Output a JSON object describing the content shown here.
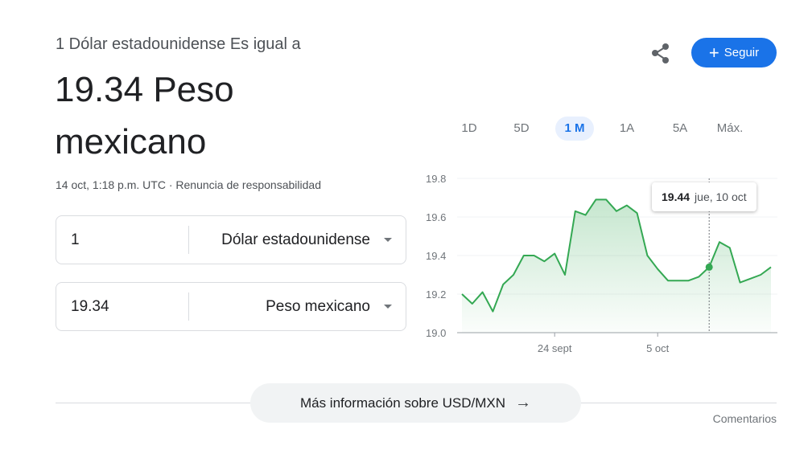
{
  "header": {
    "subtitle": "1 Dólar estadounidense Es igual a",
    "result_line1": "19.34 Peso",
    "result_line2": "mexicano",
    "timestamp": "14 oct, 1:18 p.m. UTC",
    "separator": "·",
    "disclaimer_link": "Renuncia de responsabilidad"
  },
  "actions": {
    "share_icon": "share-icon",
    "follow_label": "Seguir",
    "follow_icon": "+",
    "accent_color": "#1a73e8"
  },
  "converter": {
    "from": {
      "value": "1",
      "currency": "Dólar estadounidense"
    },
    "to": {
      "value": "19.34",
      "currency": "Peso mexicano"
    }
  },
  "ranges": {
    "items": [
      "1D",
      "5D",
      "1 M",
      "1A",
      "5A",
      "Máx."
    ],
    "selected": "1 M"
  },
  "tooltip": {
    "value": "19.44",
    "date": "jue, 10 oct"
  },
  "chart_data": {
    "type": "area",
    "line_color": "#34a853",
    "ylim": [
      19.0,
      19.8
    ],
    "y_ticks": [
      "19.8",
      "19.6",
      "19.4",
      "19.2",
      "19.0"
    ],
    "x_tick_labels": [
      {
        "label": "24 sept",
        "x": 9
      },
      {
        "label": "5 oct",
        "x": 19
      }
    ],
    "highlight_x": 24,
    "x": [
      0,
      1,
      2,
      3,
      4,
      5,
      6,
      7,
      8,
      9,
      10,
      11,
      12,
      13,
      14,
      15,
      16,
      17,
      18,
      19,
      20,
      21,
      22,
      23,
      24,
      25,
      26,
      27,
      28,
      29,
      30
    ],
    "values": [
      19.2,
      19.15,
      19.21,
      19.11,
      19.25,
      19.3,
      19.4,
      19.4,
      19.37,
      19.41,
      19.3,
      19.63,
      19.61,
      19.69,
      19.69,
      19.63,
      19.66,
      19.62,
      19.4,
      19.33,
      19.27,
      19.27,
      19.27,
      19.29,
      19.34,
      19.47,
      19.44,
      19.26,
      19.28,
      19.3,
      19.34
    ]
  },
  "more_info": {
    "label": "Más información sobre USD/MXN",
    "arrow": "→"
  },
  "footer": {
    "feedback": "Comentarios"
  }
}
